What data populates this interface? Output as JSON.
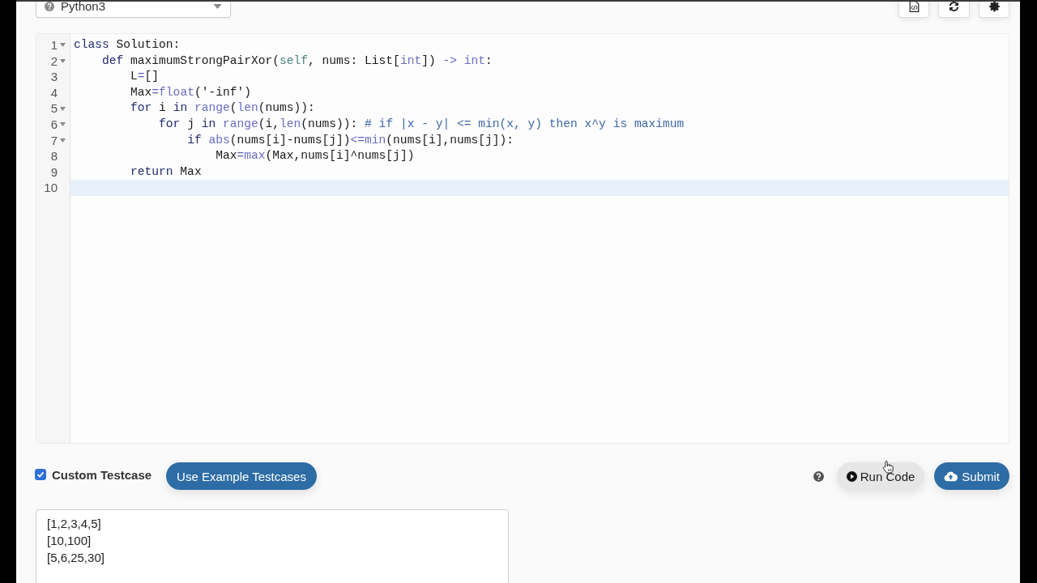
{
  "language_select": {
    "value": "Python3"
  },
  "editor": {
    "lines": [
      {
        "number": "1",
        "foldable": true,
        "active": false,
        "tokens": [
          {
            "text": "class",
            "kind": "keyword"
          },
          {
            "text": " Solution:",
            "kind": "plain"
          }
        ]
      },
      {
        "number": "2",
        "foldable": true,
        "active": false,
        "tokens": [
          {
            "text": "    def",
            "kind": "keyword"
          },
          {
            "text": " maximumStrongPairXor(",
            "kind": "plain"
          },
          {
            "text": "self",
            "kind": "self"
          },
          {
            "text": ", nums: List[",
            "kind": "plain"
          },
          {
            "text": "int",
            "kind": "builtin"
          },
          {
            "text": "]) ",
            "kind": "plain"
          },
          {
            "text": "->",
            "kind": "operator"
          },
          {
            "text": " int",
            "kind": "builtin"
          },
          {
            "text": ":",
            "kind": "plain"
          }
        ]
      },
      {
        "number": "3",
        "foldable": false,
        "active": false,
        "tokens": [
          {
            "text": "        L",
            "kind": "plain"
          },
          {
            "text": "=",
            "kind": "operator"
          },
          {
            "text": "[]",
            "kind": "plain"
          }
        ]
      },
      {
        "number": "4",
        "foldable": false,
        "active": false,
        "tokens": [
          {
            "text": "        Max",
            "kind": "plain"
          },
          {
            "text": "=",
            "kind": "operator"
          },
          {
            "text": "float",
            "kind": "builtin"
          },
          {
            "text": "('-inf')",
            "kind": "plain"
          }
        ]
      },
      {
        "number": "5",
        "foldable": true,
        "active": false,
        "tokens": [
          {
            "text": "        for",
            "kind": "keyword"
          },
          {
            "text": " i ",
            "kind": "plain"
          },
          {
            "text": "in",
            "kind": "keyword"
          },
          {
            "text": " range",
            "kind": "builtin"
          },
          {
            "text": "(",
            "kind": "plain"
          },
          {
            "text": "len",
            "kind": "builtin"
          },
          {
            "text": "(nums)):",
            "kind": "plain"
          }
        ]
      },
      {
        "number": "6",
        "foldable": true,
        "active": false,
        "tokens": [
          {
            "text": "            for",
            "kind": "keyword"
          },
          {
            "text": " j ",
            "kind": "plain"
          },
          {
            "text": "in",
            "kind": "keyword"
          },
          {
            "text": " range",
            "kind": "builtin"
          },
          {
            "text": "(i,",
            "kind": "plain"
          },
          {
            "text": "len",
            "kind": "builtin"
          },
          {
            "text": "(nums)): ",
            "kind": "plain"
          },
          {
            "text": "# if |x - y| <= min(x, y) then x^y is maximum",
            "kind": "comment"
          }
        ]
      },
      {
        "number": "7",
        "foldable": true,
        "active": false,
        "tokens": [
          {
            "text": "                if",
            "kind": "keyword"
          },
          {
            "text": " abs",
            "kind": "builtin"
          },
          {
            "text": "(nums[i]-nums[j])",
            "kind": "plain"
          },
          {
            "text": "<=",
            "kind": "operator"
          },
          {
            "text": "min",
            "kind": "builtin"
          },
          {
            "text": "(nums[i],nums[j]):",
            "kind": "plain"
          }
        ]
      },
      {
        "number": "8",
        "foldable": false,
        "active": false,
        "tokens": [
          {
            "text": "                    Max",
            "kind": "plain"
          },
          {
            "text": "=",
            "kind": "operator"
          },
          {
            "text": "max",
            "kind": "builtin"
          },
          {
            "text": "(Max,nums[i]^nums[j])",
            "kind": "plain"
          }
        ]
      },
      {
        "number": "9",
        "foldable": false,
        "active": false,
        "tokens": [
          {
            "text": "        return",
            "kind": "keyword"
          },
          {
            "text": " Max",
            "kind": "plain"
          }
        ]
      },
      {
        "number": "10",
        "foldable": false,
        "active": true
      }
    ]
  },
  "custom_testcase": {
    "label": "Custom Testcase",
    "checked": true
  },
  "example_button": "Use Example Testcases",
  "run_button": "Run Code",
  "submit_button": "Submit",
  "testcase_input": {
    "value": "[1,2,3,4,5]\n[10,100]\n[5,6,25,30]"
  }
}
